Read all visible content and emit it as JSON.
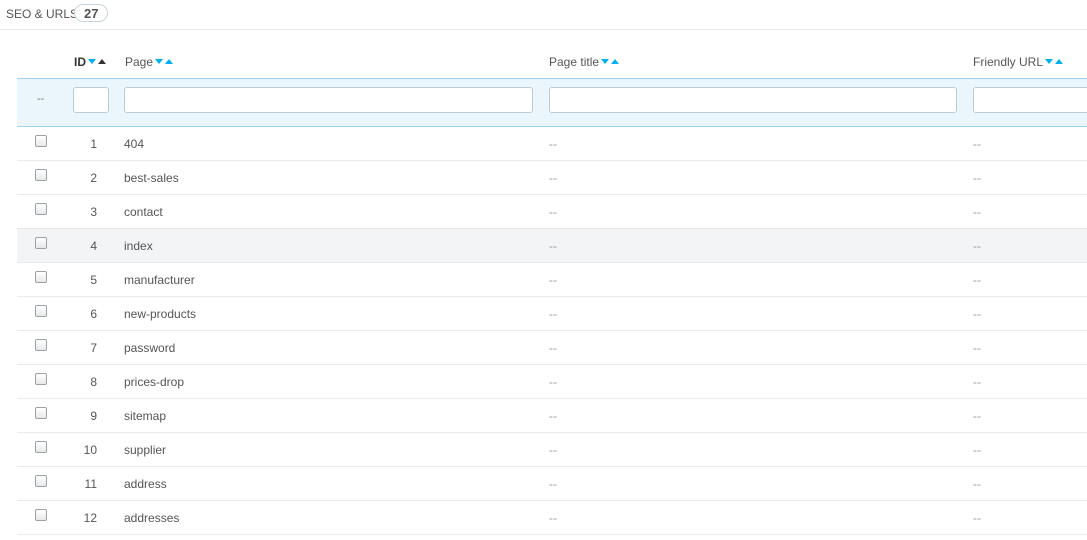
{
  "panel": {
    "title": "SEO & URLs",
    "count": "27"
  },
  "columns": {
    "id": "ID",
    "page": "Page",
    "page_title": "Page title",
    "friendly_url": "Friendly URL"
  },
  "filters": {
    "bulk_placeholder": "--",
    "id": "",
    "page": "",
    "page_title": "",
    "friendly_url": ""
  },
  "sort": {
    "active_column": "id",
    "active_direction": "asc"
  },
  "rows": [
    {
      "id": "1",
      "page": "404",
      "page_title": "--",
      "friendly_url": "--"
    },
    {
      "id": "2",
      "page": "best-sales",
      "page_title": "--",
      "friendly_url": "--"
    },
    {
      "id": "3",
      "page": "contact",
      "page_title": "--",
      "friendly_url": "--"
    },
    {
      "id": "4",
      "page": "index",
      "page_title": "--",
      "friendly_url": "--"
    },
    {
      "id": "5",
      "page": "manufacturer",
      "page_title": "--",
      "friendly_url": "--"
    },
    {
      "id": "6",
      "page": "new-products",
      "page_title": "--",
      "friendly_url": "--"
    },
    {
      "id": "7",
      "page": "password",
      "page_title": "--",
      "friendly_url": "--"
    },
    {
      "id": "8",
      "page": "prices-drop",
      "page_title": "--",
      "friendly_url": "--"
    },
    {
      "id": "9",
      "page": "sitemap",
      "page_title": "--",
      "friendly_url": "--"
    },
    {
      "id": "10",
      "page": "supplier",
      "page_title": "--",
      "friendly_url": "--"
    },
    {
      "id": "11",
      "page": "address",
      "page_title": "--",
      "friendly_url": "--"
    },
    {
      "id": "12",
      "page": "addresses",
      "page_title": "--",
      "friendly_url": "--"
    }
  ],
  "colors": {
    "accent": "#00aff0",
    "filter_bg": "#eaf6fc",
    "border": "#a0d0eb"
  }
}
